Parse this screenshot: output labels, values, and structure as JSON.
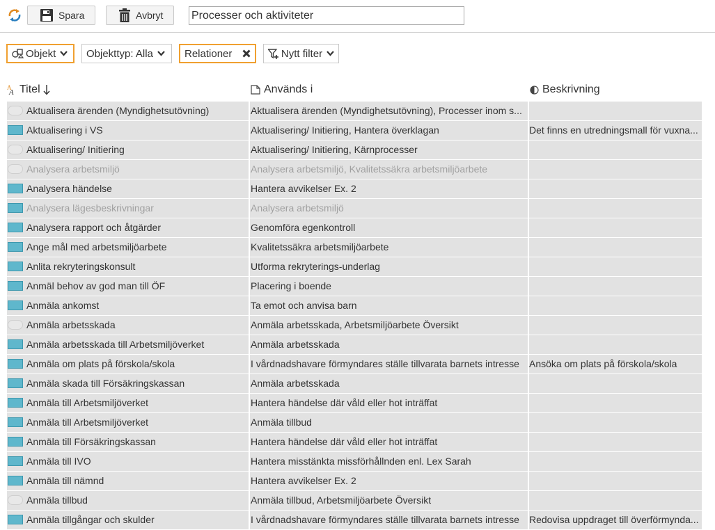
{
  "toolbar": {
    "save_label": "Spara",
    "cancel_label": "Avbryt",
    "title_value": "Processer och aktiviteter"
  },
  "filters": {
    "objekt_label": "Objekt",
    "objekttyp_label": "Objekttyp: Alla",
    "relationer_label": "Relationer",
    "nytt_filter_label": "Nytt filter"
  },
  "columns": {
    "title": "Titel",
    "used_in": "Används i",
    "description": "Beskrivning"
  },
  "colors": {
    "accent_orange": "#f0a030",
    "folder_blue": "#5fb7cc",
    "row_grey": "#e2e2e2"
  },
  "rows": [
    {
      "icon": "empty-item-icon",
      "title": "Aktualisera ärenden (Myndighetsutövning)",
      "used_in": "Aktualisera ärenden (Myndighetsutövning), Processer inom s...",
      "description": "",
      "dim": false
    },
    {
      "icon": "folder-icon",
      "title": "Aktualisering i VS",
      "used_in": "Aktualisering/ Initiering, Hantera överklagan",
      "description": "Det finns en utredningsmall för vuxna...",
      "dim": false
    },
    {
      "icon": "empty-item-icon",
      "title": "Aktualisering/ Initiering",
      "used_in": "Aktualisering/ Initiering, Kärnprocesser",
      "description": "",
      "dim": false
    },
    {
      "icon": "empty-item-icon",
      "title": "Analysera arbetsmiljö",
      "used_in": "Analysera arbetsmiljö, Kvalitetssäkra arbetsmiljöarbete",
      "description": "",
      "dim": true
    },
    {
      "icon": "folder-icon",
      "title": "Analysera händelse",
      "used_in": "Hantera avvikelser Ex. 2",
      "description": "",
      "dim": false
    },
    {
      "icon": "folder-icon",
      "title": "Analysera lägesbeskrivningar",
      "used_in": "Analysera arbetsmiljö",
      "description": "",
      "dim": true
    },
    {
      "icon": "folder-icon",
      "title": "Analysera rapport och åtgärder",
      "used_in": "Genomföra egenkontroll",
      "description": "",
      "dim": false
    },
    {
      "icon": "folder-icon",
      "title": "Ange mål med arbetsmiljöarbete",
      "used_in": "Kvalitetssäkra arbetsmiljöarbete",
      "description": "",
      "dim": false
    },
    {
      "icon": "folder-icon",
      "title": "Anlita rekryteringskonsult",
      "used_in": "Utforma rekryterings-underlag",
      "description": "",
      "dim": false
    },
    {
      "icon": "folder-icon",
      "title": "Anmäl behov av god man till ÖF",
      "used_in": "Placering i boende",
      "description": "",
      "dim": false
    },
    {
      "icon": "folder-icon",
      "title": "Anmäla ankomst",
      "used_in": "Ta emot och anvisa barn",
      "description": "",
      "dim": false
    },
    {
      "icon": "empty-item-icon",
      "title": "Anmäla arbetsskada",
      "used_in": "Anmäla arbetsskada, Arbetsmiljöarbete Översikt",
      "description": "",
      "dim": false
    },
    {
      "icon": "folder-icon",
      "title": "Anmäla arbetsskada till Arbetsmiljöverket",
      "used_in": "Anmäla arbetsskada",
      "description": "",
      "dim": false
    },
    {
      "icon": "folder-icon",
      "title": "Anmäla om plats på förskola/skola",
      "used_in": "I vårdnadshavare förmyndares ställe tillvarata barnets intresse",
      "description": "Ansöka om plats på förskola/skola",
      "dim": false
    },
    {
      "icon": "folder-icon",
      "title": "Anmäla skada till Försäkringskassan",
      "used_in": "Anmäla arbetsskada",
      "description": "",
      "dim": false
    },
    {
      "icon": "folder-icon",
      "title": "Anmäla till Arbetsmiljöverket",
      "used_in": "Hantera händelse där våld eller hot inträffat",
      "description": "",
      "dim": false
    },
    {
      "icon": "folder-icon",
      "title": "Anmäla till Arbetsmiljöverket",
      "used_in": "Anmäla tillbud",
      "description": "",
      "dim": false
    },
    {
      "icon": "folder-icon",
      "title": "Anmäla till Försäkringskassan",
      "used_in": "Hantera händelse där våld eller hot inträffat",
      "description": "",
      "dim": false
    },
    {
      "icon": "folder-icon",
      "title": "Anmäla till IVO",
      "used_in": "Hantera misstänkta missförhållnden enl. Lex Sarah",
      "description": "",
      "dim": false
    },
    {
      "icon": "folder-icon",
      "title": "Anmäla till nämnd",
      "used_in": "Hantera avvikelser Ex. 2",
      "description": "",
      "dim": false
    },
    {
      "icon": "empty-item-icon",
      "title": "Anmäla tillbud",
      "used_in": "Anmäla tillbud, Arbetsmiljöarbete Översikt",
      "description": "",
      "dim": false
    },
    {
      "icon": "folder-icon",
      "title": "Anmäla tillgångar och skulder",
      "used_in": "I vårdnadshavare förmyndares ställe tillvarata barnets intresse",
      "description": "Redovisa uppdraget till överförmynda...",
      "dim": false
    }
  ]
}
